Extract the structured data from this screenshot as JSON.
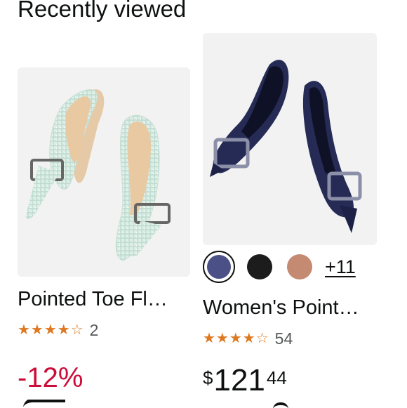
{
  "section": {
    "title": "Recently viewed"
  },
  "products": [
    {
      "title": "Pointed Toe Fl…",
      "stars": "★★★★☆",
      "rating_value": 4.0,
      "rating_count": "2",
      "discount": "-12%"
    },
    {
      "title": "Women's Point…",
      "stars": "★★★★☆",
      "rating_value": 4.5,
      "rating_count": "54",
      "price_symbol": "$",
      "price_whole": "121",
      "price_fraction": "44",
      "swatches": [
        {
          "name": "navy",
          "color": "#4b5186",
          "selected": true
        },
        {
          "name": "black",
          "color": "#1c1c1c",
          "selected": false
        },
        {
          "name": "tan",
          "color": "#c48a72",
          "selected": false
        }
      ],
      "more_colors": "+11"
    }
  ],
  "colors": {
    "star": "#de7921",
    "discount": "#cc0c39",
    "text": "#0f1111",
    "muted": "#565959"
  }
}
